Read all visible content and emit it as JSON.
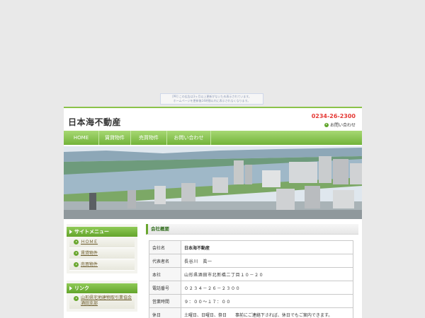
{
  "ad": {
    "line1": "[PR] この広告は3ヶ月以上更新がないため表示されています。",
    "line2": "ホームページを更新後24時間以内に表示されなくなります。"
  },
  "header": {
    "title": "日本海不動産",
    "phone": "0234-26-2300",
    "contact_link": "お問い合わせ"
  },
  "nav": {
    "items": [
      "HOME",
      "賃貸物件",
      "売買物件",
      "お問い合わせ"
    ]
  },
  "sidebar": {
    "menu_title": "サイトメニュー",
    "menu_items": [
      "ＨＯＭＥ",
      "賃貸物件",
      "売買物件"
    ],
    "link_title": "リンク",
    "link_items": [
      "山形県宅地建物取引業協会酒田支部"
    ]
  },
  "main": {
    "section_title": "会社概要",
    "table": [
      {
        "label": "会社名",
        "value": "日本海不動産"
      },
      {
        "label": "代表者名",
        "value": "長谷川　眞一"
      },
      {
        "label": "本社",
        "value": "山形県酒田市北新橋二丁目１０－２０"
      },
      {
        "label": "電話番号",
        "value": "０２３４－２６－２３００"
      },
      {
        "label": "営業時間",
        "value": "９：００～１７：００"
      },
      {
        "label": "休日",
        "value": "土曜日、日曜日、祭日　　事前にご連絡下されば、休日でもご案内できます。"
      }
    ]
  }
}
